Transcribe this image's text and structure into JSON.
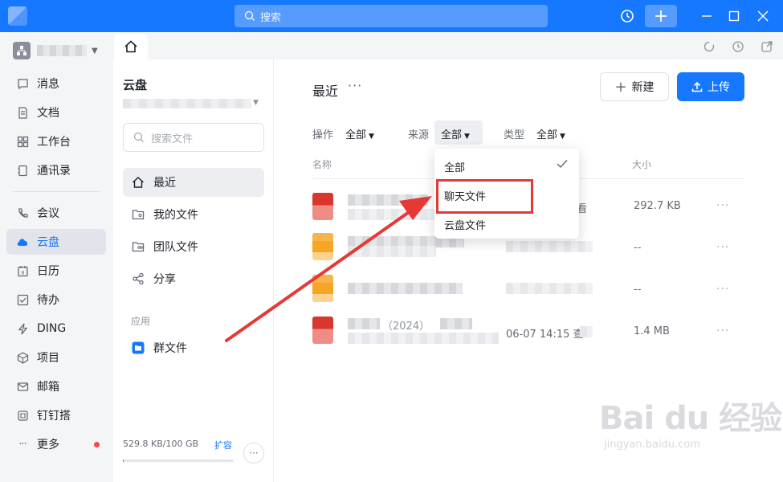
{
  "titlebar": {
    "search_placeholder": "搜索"
  },
  "leftnav": {
    "items": [
      {
        "label": "消息",
        "icon": "message-icon"
      },
      {
        "label": "文档",
        "icon": "document-icon"
      },
      {
        "label": "工作台",
        "icon": "workbench-icon"
      },
      {
        "label": "通讯录",
        "icon": "contacts-icon"
      },
      {
        "label": "会议",
        "icon": "phone-icon"
      },
      {
        "label": "云盘",
        "icon": "cloud-icon",
        "active": true
      },
      {
        "label": "日历",
        "icon": "calendar-icon"
      },
      {
        "label": "待办",
        "icon": "todo-icon"
      },
      {
        "label": "DING",
        "icon": "lightning-icon"
      },
      {
        "label": "项目",
        "icon": "project-icon"
      },
      {
        "label": "邮箱",
        "icon": "mail-icon"
      },
      {
        "label": "钉钉搭",
        "icon": "builder-icon"
      },
      {
        "label": "更多",
        "icon": "more-icon"
      }
    ]
  },
  "drive": {
    "title": "云盘",
    "search_placeholder": "搜索文件",
    "nav": [
      {
        "label": "最近",
        "active": true
      },
      {
        "label": "我的文件"
      },
      {
        "label": "团队文件"
      },
      {
        "label": "分享"
      }
    ],
    "apps_label": "应用",
    "apps": [
      {
        "label": "群文件"
      }
    ],
    "usage": "529.8 KB/100 GB",
    "usage_fraction": 5e-06,
    "expand_label": "扩容"
  },
  "main": {
    "title": "最近",
    "new_label": "新建",
    "upload_label": "上传",
    "filters": {
      "op_label": "操作",
      "op_value": "全部",
      "src_label": "来源",
      "src_value": "全部",
      "type_label": "类型",
      "type_value": "全部"
    },
    "columns": {
      "name": "名称",
      "size": "大小"
    },
    "rows": [
      {
        "type": "pdf",
        "time_suffix": "看",
        "size": "292.7 KB"
      },
      {
        "type": "folder",
        "size": "--"
      },
      {
        "type": "folder",
        "size": "--"
      },
      {
        "type": "pdf",
        "name_visible": "（2024）",
        "time": "06-07 14:15 查",
        "size": "1.4 MB"
      }
    ],
    "dropdown": {
      "options": [
        "全部",
        "聊天文件",
        "云盘文件"
      ],
      "selected": "全部",
      "highlighted": "聊天文件"
    }
  },
  "watermark": {
    "main": "Bai du 经验",
    "sub": "jingyan.baidu.com"
  },
  "colors": {
    "brand": "#1677ff",
    "annotation": "#e53935"
  }
}
